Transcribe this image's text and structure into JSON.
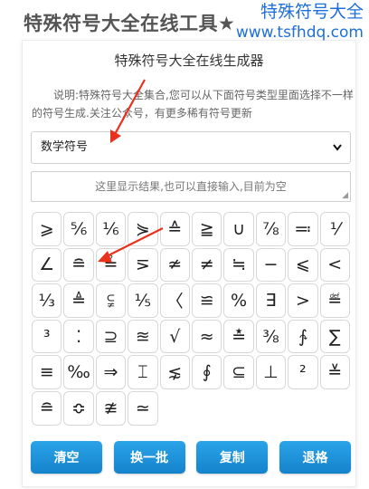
{
  "page": {
    "title": "特殊符号大全在线工具★",
    "watermark_cn": "特殊符号大全",
    "watermark_url": "www.tsfhdq.com"
  },
  "panel": {
    "header": "特殊符号大全在线生成器",
    "description": "说明:特殊符号大全集合,您可以从下面符号类型里面选择不一样的符号生成.关注公众号，有更多稀有符号更新",
    "select_value": "数学符号",
    "result_placeholder": "这里显示结果,也可以直接输入,目前为空"
  },
  "symbols": [
    "⩾",
    "⅚",
    "⅙",
    "⋟",
    "≙",
    "≧",
    "∪",
    "⅞",
    "≕",
    "⅟",
    "∠",
    "≘",
    "≟",
    "⋝",
    "≄",
    "≠",
    "≒",
    "−",
    "⩽",
    "<",
    "⅓",
    "≜",
    "⫋",
    "⅕",
    "〈",
    "≌",
    "%",
    "∃",
    ">",
    "≝",
    "³",
    "⁚",
    "⊇",
    "≊",
    "√",
    "≈",
    "≛",
    "⅜",
    "∱",
    "∑",
    "≡",
    "‰",
    "⇒",
    "⌶",
    "⋦",
    "∮",
    "⊆",
    "⊥",
    "²",
    "≚",
    "≘",
    "≎",
    "≇",
    "≃"
  ],
  "buttons": {
    "clear": "清空",
    "refresh": "换一批",
    "copy": "复制",
    "backspace": "退格"
  },
  "colors": {
    "button": "#1a8fd8",
    "watermark": "#1e6fd9",
    "arrow": "#e8321e"
  }
}
